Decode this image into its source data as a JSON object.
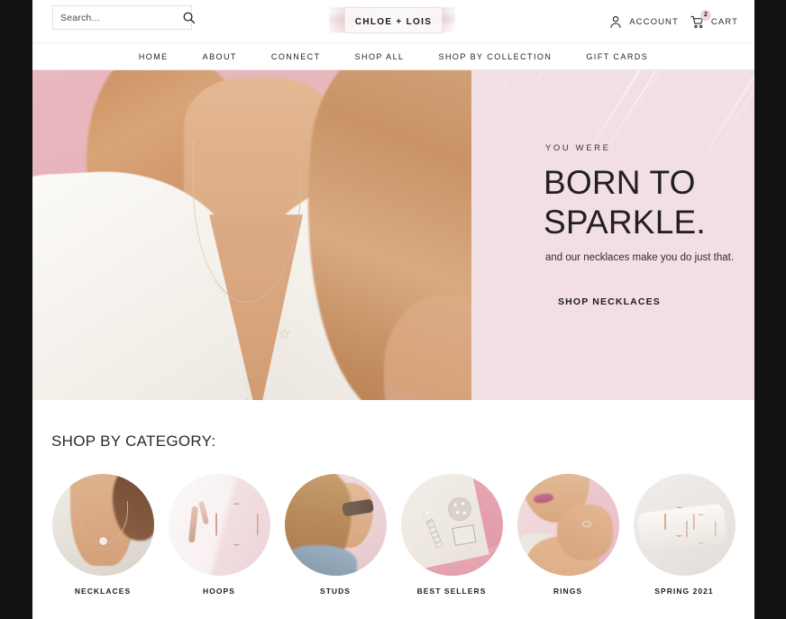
{
  "brand": {
    "logo_text": "CHLOE + LOIS"
  },
  "search": {
    "placeholder": "Search...",
    "value": "",
    "icon": "search-icon"
  },
  "utility": {
    "account_label": "ACCOUNT",
    "account_icon": "person-icon",
    "cart_label": "CART",
    "cart_icon": "shopping-cart-icon",
    "cart_count": "2"
  },
  "nav": {
    "items": [
      {
        "label": "HOME"
      },
      {
        "label": "ABOUT"
      },
      {
        "label": "CONNECT"
      },
      {
        "label": "SHOP ALL"
      },
      {
        "label": "SHOP BY COLLECTION"
      },
      {
        "label": "GIFT CARDS"
      }
    ]
  },
  "hero": {
    "eyebrow": "YOU WERE",
    "headline": "BORN TO\nSPARKLE.",
    "subcopy": "and our necklaces make you do just that.",
    "cta_label": "SHOP NECKLACES",
    "background_color": "#f2dfe3",
    "photo_accent_color": "#e8b8bd"
  },
  "category_section": {
    "title": "SHOP BY CATEGORY:",
    "items": [
      {
        "label": "NECKLACES"
      },
      {
        "label": "HOOPS"
      },
      {
        "label": "STUDS"
      },
      {
        "label": "BEST SELLERS"
      },
      {
        "label": "RINGS"
      },
      {
        "label": "SPRING 2021"
      }
    ]
  },
  "theme": {
    "page_background": "#111111",
    "content_background": "#ffffff",
    "accent_pink": "#efd4d8",
    "text_dark": "#1d1d1d"
  }
}
